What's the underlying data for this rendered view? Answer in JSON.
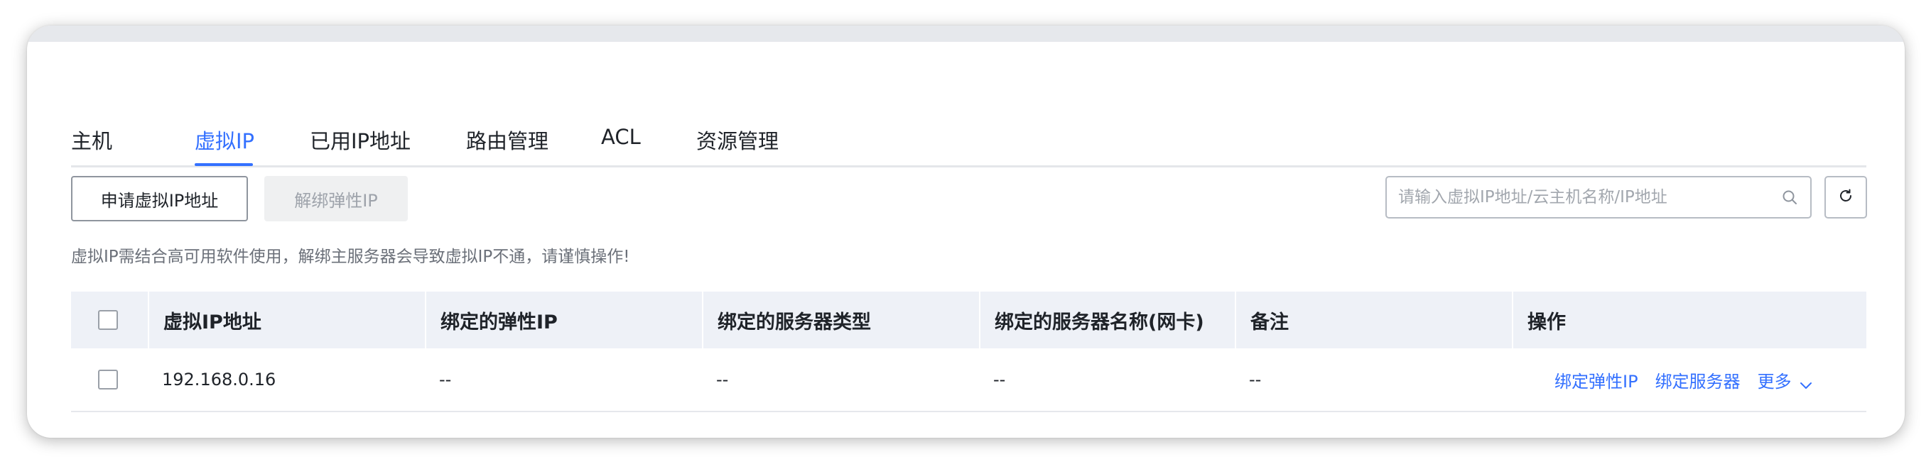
{
  "tabs": [
    {
      "label": "主机"
    },
    {
      "label": "虚拟IP"
    },
    {
      "label": "已用IP地址"
    },
    {
      "label": "路由管理"
    },
    {
      "label": "ACL"
    },
    {
      "label": "资源管理"
    }
  ],
  "active_tab": "虚拟IP",
  "toolbar": {
    "apply_label": "申请虚拟IP地址",
    "unbind_label": "解绑弹性IP"
  },
  "search": {
    "placeholder": "请输入虚拟IP地址/云主机名称/IP地址",
    "value": ""
  },
  "icons": {
    "search": "search-icon",
    "refresh": "refresh-icon",
    "more": "chevron-down-icon"
  },
  "hint": "虚拟IP需结合高可用软件使用，解绑主服务器会导致虚拟IP不通，请谨慎操作!",
  "table": {
    "columns": [
      "虚拟IP地址",
      "绑定的弹性IP",
      "绑定的服务器类型",
      "绑定的服务器名称(网卡)",
      "备注",
      "操作"
    ],
    "rows": [
      {
        "ip": "192.168.0.16",
        "eip": "--",
        "server_type": "--",
        "server_name": "--",
        "remark": "--",
        "actions": [
          "绑定弹性IP",
          "绑定服务器"
        ],
        "more": "更多"
      }
    ]
  },
  "colors": {
    "accent": "#3370ff",
    "header_bg": "#eef1f7",
    "text": "#1f2329",
    "muted": "#6b7079"
  }
}
